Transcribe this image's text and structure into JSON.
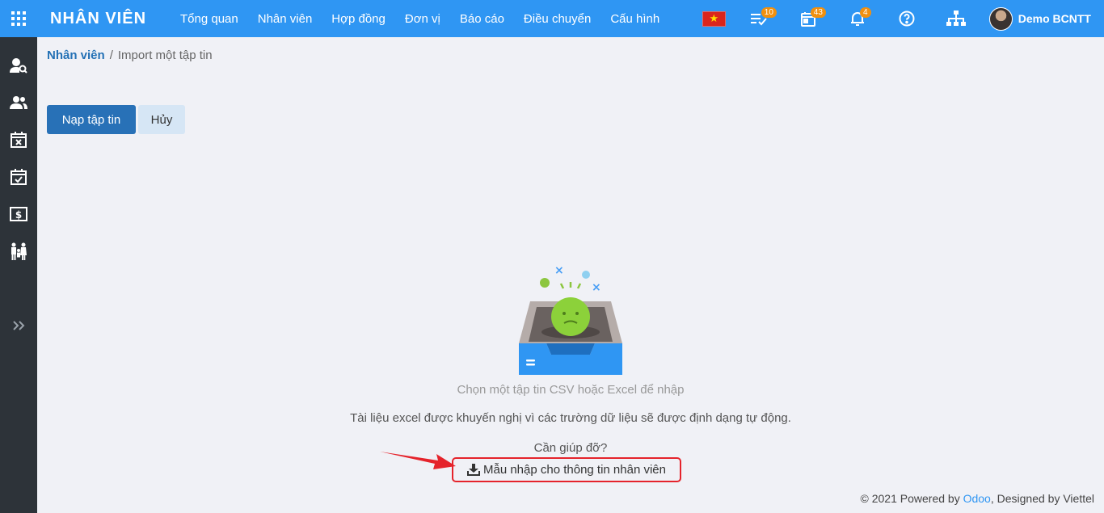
{
  "topbar": {
    "app_title": "NHÂN VIÊN",
    "menu": [
      "Tổng quan",
      "Nhân viên",
      "Hợp đồng",
      "Đơn vị",
      "Báo cáo",
      "Điều chuyển",
      "Cấu hình"
    ],
    "badges": {
      "activities": "10",
      "calendar": "43",
      "notifications": "4"
    },
    "user_name": "Demo BCNTT",
    "language_flag": "vietnam-flag"
  },
  "sidebar": {
    "icons": [
      "user-search-icon",
      "users-icon",
      "calendar-x-icon",
      "calendar-check-icon",
      "money-icon",
      "family-icon",
      "expand-icon"
    ]
  },
  "breadcrumb": {
    "parent": "Nhân viên",
    "separator": "/",
    "current": "Import một tập tin"
  },
  "actions": {
    "load_file": "Nạp tập tin",
    "cancel": "Hủy"
  },
  "main": {
    "hint_choose": "Chọn một tập tin CSV hoặc Excel để nhập",
    "hint_excel": "Tài liệu excel được khuyến nghị vì các trường dữ liệu sẽ được định dạng tự động.",
    "help_label": "Cần giúp đỡ?",
    "template_link": "Mẫu nhập cho thông tin nhân viên"
  },
  "footer": {
    "prefix": "© 2021 Powered by ",
    "odoo": "Odoo",
    "suffix": ", Designed by Viettel"
  },
  "colors": {
    "topbar": "#2f96f3",
    "sidebar": "#2d3339",
    "primary": "#2871b7",
    "highlight": "#e5232b"
  }
}
